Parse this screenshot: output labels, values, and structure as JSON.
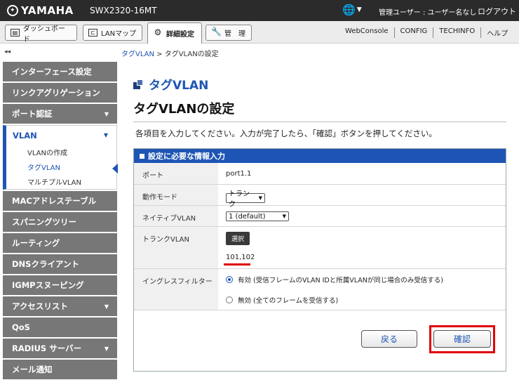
{
  "header": {
    "brand": "YAMAHA",
    "model": "SWX2320-16MT",
    "language_icon": "globe-icon",
    "user_info": "管理ユーザー : ユーザー名なし",
    "logout": "ログアウト",
    "colors": {
      "header_bg": "#2b2b2b",
      "accent": "#1e55b4",
      "highlight": "#e00000"
    }
  },
  "toolbar": {
    "tabs": [
      {
        "label": "ダッシュボード",
        "icon": "dashboard-icon"
      },
      {
        "label": "LANマップ",
        "icon": "lan-map-icon"
      },
      {
        "label": "詳細設定",
        "icon": "gear-icon",
        "active": true
      },
      {
        "label": "管　理",
        "icon": "wrench-icon"
      }
    ],
    "links": [
      "WebConsole",
      "CONFIG",
      "TECHINFO",
      "ヘルプ"
    ]
  },
  "sidebar": {
    "collapse": "◂◂",
    "items": [
      {
        "label": "インターフェース設定"
      },
      {
        "label": "リンクアグリゲーション"
      },
      {
        "label": "ポート認証",
        "caret": "▼"
      },
      {
        "label": "VLAN",
        "caret": "▼",
        "active": true
      },
      {
        "label": "MACアドレステーブル"
      },
      {
        "label": "スパニングツリー"
      },
      {
        "label": "ルーティング"
      },
      {
        "label": "DNSクライアント"
      },
      {
        "label": "IGMPスヌーピング"
      },
      {
        "label": "アクセスリスト",
        "caret": "▼"
      },
      {
        "label": "QoS"
      },
      {
        "label": "RADIUS サーバー",
        "caret": "▼"
      },
      {
        "label": "メール通知"
      }
    ],
    "vlan_sub": [
      {
        "label": "VLANの作成"
      },
      {
        "label": "タグVLAN",
        "active": true
      },
      {
        "label": "マルチプルVLAN"
      }
    ]
  },
  "breadcrumb": {
    "parent": "タグVLAN",
    "separator": " > ",
    "current": "タグVLANの設定"
  },
  "section_title": "タグVLAN",
  "page_title": "タグVLANの設定",
  "instructions": "各項目を入力してください。入力が完了したら、「確認」ボタンを押してください。",
  "panel": {
    "title": "設定に必要な情報入力",
    "port": {
      "label": "ポート",
      "value": "port1.1"
    },
    "mode": {
      "label": "動作モード",
      "value": "トランク"
    },
    "native_vlan": {
      "label": "ネイティブVLAN",
      "value": "1 (default)"
    },
    "trunk_vlan": {
      "label": "トランクVLAN",
      "button": "選択",
      "value": "101,102"
    },
    "ingress_filter": {
      "label": "イングレスフィルター",
      "options": [
        {
          "label": "有効 (受信フレームのVLAN IDと所属VLANが同じ場合のみ受信する)",
          "selected": true
        },
        {
          "label": "無効 (全てのフレームを受信する)",
          "selected": false
        }
      ]
    }
  },
  "buttons": {
    "back": "戻る",
    "confirm": "確認"
  }
}
